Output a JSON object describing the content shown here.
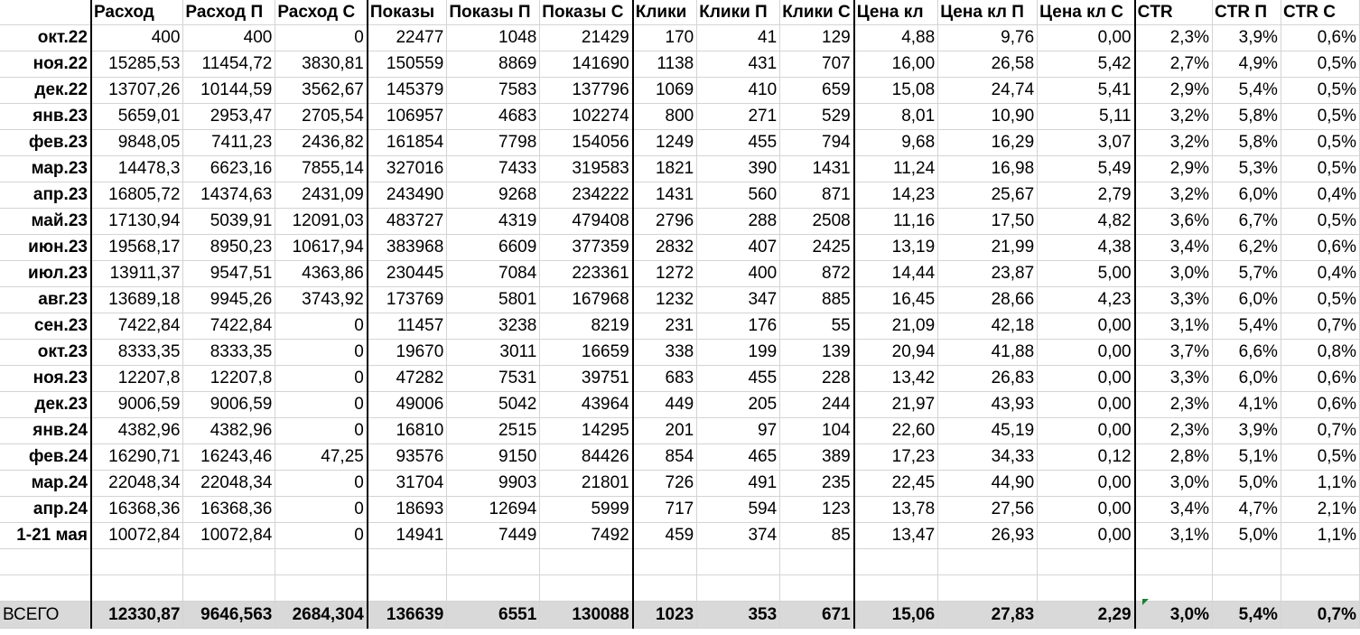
{
  "headers": [
    "",
    "Расход",
    "Расход П",
    "Расход С",
    "Показы",
    "Показы П",
    "Показы С",
    "Клики",
    "Клики П",
    "Клики С",
    "Цена кл",
    "Цена кл П",
    "Цена кл С",
    "CTR",
    "CTR П",
    "CTR С"
  ],
  "rows": [
    [
      "окт.22",
      "400",
      "400",
      "0",
      "22477",
      "1048",
      "21429",
      "170",
      "41",
      "129",
      "4,88",
      "9,76",
      "0,00",
      "2,3%",
      "3,9%",
      "0,6%"
    ],
    [
      "ноя.22",
      "15285,53",
      "11454,72",
      "3830,81",
      "150559",
      "8869",
      "141690",
      "1138",
      "431",
      "707",
      "16,00",
      "26,58",
      "5,42",
      "2,7%",
      "4,9%",
      "0,5%"
    ],
    [
      "дек.22",
      "13707,26",
      "10144,59",
      "3562,67",
      "145379",
      "7583",
      "137796",
      "1069",
      "410",
      "659",
      "15,08",
      "24,74",
      "5,41",
      "2,9%",
      "5,4%",
      "0,5%"
    ],
    [
      "янв.23",
      "5659,01",
      "2953,47",
      "2705,54",
      "106957",
      "4683",
      "102274",
      "800",
      "271",
      "529",
      "8,01",
      "10,90",
      "5,11",
      "3,2%",
      "5,8%",
      "0,5%"
    ],
    [
      "фев.23",
      "9848,05",
      "7411,23",
      "2436,82",
      "161854",
      "7798",
      "154056",
      "1249",
      "455",
      "794",
      "9,68",
      "16,29",
      "3,07",
      "3,2%",
      "5,8%",
      "0,5%"
    ],
    [
      "мар.23",
      "14478,3",
      "6623,16",
      "7855,14",
      "327016",
      "7433",
      "319583",
      "1821",
      "390",
      "1431",
      "11,24",
      "16,98",
      "5,49",
      "2,9%",
      "5,3%",
      "0,5%"
    ],
    [
      "апр.23",
      "16805,72",
      "14374,63",
      "2431,09",
      "243490",
      "9268",
      "234222",
      "1431",
      "560",
      "871",
      "14,23",
      "25,67",
      "2,79",
      "3,2%",
      "6,0%",
      "0,4%"
    ],
    [
      "май.23",
      "17130,94",
      "5039,91",
      "12091,03",
      "483727",
      "4319",
      "479408",
      "2796",
      "288",
      "2508",
      "11,16",
      "17,50",
      "4,82",
      "3,6%",
      "6,7%",
      "0,5%"
    ],
    [
      "июн.23",
      "19568,17",
      "8950,23",
      "10617,94",
      "383968",
      "6609",
      "377359",
      "2832",
      "407",
      "2425",
      "13,19",
      "21,99",
      "4,38",
      "3,4%",
      "6,2%",
      "0,6%"
    ],
    [
      "июл.23",
      "13911,37",
      "9547,51",
      "4363,86",
      "230445",
      "7084",
      "223361",
      "1272",
      "400",
      "872",
      "14,44",
      "23,87",
      "5,00",
      "3,0%",
      "5,7%",
      "0,4%"
    ],
    [
      "авг.23",
      "13689,18",
      "9945,26",
      "3743,92",
      "173769",
      "5801",
      "167968",
      "1232",
      "347",
      "885",
      "16,45",
      "28,66",
      "4,23",
      "3,3%",
      "6,0%",
      "0,5%"
    ],
    [
      "сен.23",
      "7422,84",
      "7422,84",
      "0",
      "11457",
      "3238",
      "8219",
      "231",
      "176",
      "55",
      "21,09",
      "42,18",
      "0,00",
      "3,1%",
      "5,4%",
      "0,7%"
    ],
    [
      "окт.23",
      "8333,35",
      "8333,35",
      "0",
      "19670",
      "3011",
      "16659",
      "338",
      "199",
      "139",
      "20,94",
      "41,88",
      "0,00",
      "3,7%",
      "6,6%",
      "0,8%"
    ],
    [
      "ноя.23",
      "12207,8",
      "12207,8",
      "0",
      "47282",
      "7531",
      "39751",
      "683",
      "455",
      "228",
      "13,42",
      "26,83",
      "0,00",
      "3,3%",
      "6,0%",
      "0,6%"
    ],
    [
      "дек.23",
      "9006,59",
      "9006,59",
      "0",
      "49006",
      "5042",
      "43964",
      "449",
      "205",
      "244",
      "21,97",
      "43,93",
      "0,00",
      "2,3%",
      "4,1%",
      "0,6%"
    ],
    [
      "янв.24",
      "4382,96",
      "4382,96",
      "0",
      "16810",
      "2515",
      "14295",
      "201",
      "97",
      "104",
      "22,60",
      "45,19",
      "0,00",
      "2,3%",
      "3,9%",
      "0,7%"
    ],
    [
      "фев.24",
      "16290,71",
      "16243,46",
      "47,25",
      "93576",
      "9150",
      "84426",
      "854",
      "465",
      "389",
      "17,23",
      "34,33",
      "0,12",
      "2,8%",
      "5,1%",
      "0,5%"
    ],
    [
      "мар.24",
      "22048,34",
      "22048,34",
      "0",
      "31704",
      "9903",
      "21801",
      "726",
      "491",
      "235",
      "22,45",
      "44,90",
      "0,00",
      "3,0%",
      "5,0%",
      "1,1%"
    ],
    [
      "апр.24",
      "16368,36",
      "16368,36",
      "0",
      "18693",
      "12694",
      "5999",
      "717",
      "594",
      "123",
      "13,78",
      "27,56",
      "0,00",
      "3,4%",
      "4,7%",
      "2,1%"
    ],
    [
      "1-21 мая",
      "10072,84",
      "10072,84",
      "0",
      "14941",
      "7449",
      "7492",
      "459",
      "374",
      "85",
      "13,47",
      "26,93",
      "0,00",
      "3,1%",
      "5,0%",
      "1,1%"
    ]
  ],
  "total": [
    "ВСЕГО",
    "12330,87",
    "9646,563",
    "2684,304",
    "136639",
    "6551",
    "130088",
    "1023",
    "353",
    "671",
    "15,06",
    "27,83",
    "2,29",
    "3,0%",
    "5,4%",
    "0,7%"
  ],
  "colors": {
    "grid": "#d4d4d4",
    "total_bg": "#d9d9d9",
    "error_tick": "#1e7e34"
  }
}
